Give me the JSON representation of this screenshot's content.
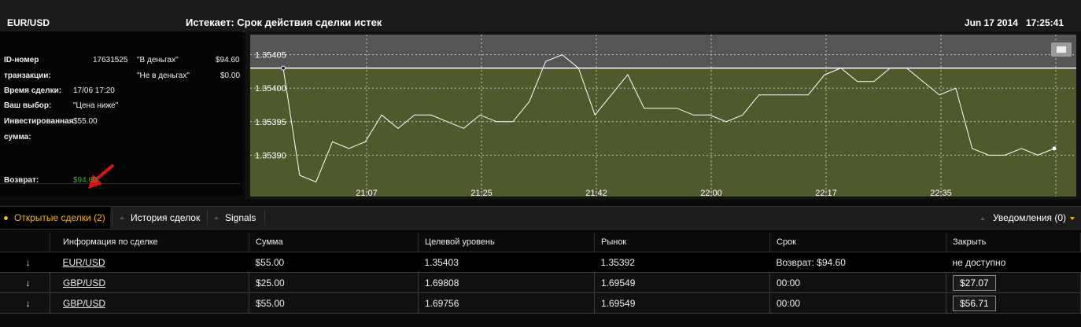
{
  "header": {
    "pair": "EUR/USD",
    "expiry": "Истекает:  Срок действия сделки истек",
    "date": "Jun 17 2014",
    "time": "17:25:41"
  },
  "info": {
    "id_label": "ID-номер",
    "id_label2": "транзакции:",
    "id_value": "17631525",
    "in_money_label": "\"В деньгах\"",
    "in_money_value": "$94.60",
    "out_money_label": "\"Не в деньгах\"",
    "out_money_value": "$0.00",
    "time_label": "Время сделки:",
    "time_value": "17/06 17:20",
    "choice_label": "Ваш выбор:",
    "choice_value": "\"Цена ниже\"",
    "invest_label": "Инвестированная",
    "invest_label2": "сумма:",
    "invest_value": "$55.00",
    "return_label": "Возврат:",
    "return_value": "$94.60"
  },
  "chart_data": {
    "type": "line",
    "x_ticks": [
      "21:07",
      "21:25",
      "21:42",
      "22:00",
      "22:17",
      "22:35"
    ],
    "y_ticks": [
      1.35405,
      1.354,
      1.35395,
      1.3539
    ],
    "y_tick_labels": [
      "1.35405",
      "1.35400",
      "1.35395",
      "1.35390"
    ],
    "ylim": [
      1.35385,
      1.35408
    ],
    "target_level": 1.35403,
    "grid": true,
    "series": [
      {
        "values": [
          1.35403,
          1.35387,
          1.35386,
          1.35392,
          1.35391,
          1.35392,
          1.35396,
          1.35394,
          1.35396,
          1.35396,
          1.35395,
          1.35394,
          1.35396,
          1.35395,
          1.35395,
          1.35398,
          1.35404,
          1.35405,
          1.35403,
          1.35396,
          1.35399,
          1.35402,
          1.35397,
          1.35397,
          1.35397,
          1.35396,
          1.35396,
          1.35395,
          1.35396,
          1.35399,
          1.35399,
          1.35399,
          1.35399,
          1.35402,
          1.35403,
          1.35401,
          1.35401,
          1.35403,
          1.35403,
          1.35401,
          1.35399,
          1.354,
          1.35391,
          1.3539,
          1.3539,
          1.35391,
          1.3539,
          1.35391
        ]
      }
    ]
  },
  "tabs": {
    "open": "Открытые сделки (2)",
    "history": "История сделок",
    "signals": "Signals",
    "notifications": "Уведомления (0)"
  },
  "table": {
    "headers": [
      "Информация по сделке",
      "Сумма",
      "Целевой уровень",
      "Рынок",
      "Срок",
      "Закрыть"
    ],
    "rows": [
      {
        "arrow": "↓",
        "pair": "EUR/USD",
        "amount": "$55.00",
        "target": "1.35403",
        "market": "1.35392",
        "term": "Возврат: $94.60",
        "close": "не доступно"
      },
      {
        "arrow": "↓",
        "pair": "GBP/USD",
        "amount": "$25.00",
        "target": "1.69808",
        "market": "1.69549",
        "term": "00:00",
        "close": "$27.07"
      },
      {
        "arrow": "↓",
        "pair": "GBP/USD",
        "amount": "$55.00",
        "target": "1.69756",
        "market": "1.69549",
        "term": "00:00",
        "close": "$56.71"
      }
    ]
  },
  "colors": {
    "accent": "#f0b800",
    "positive": "#2bb52b",
    "plot_bg": "#4e5a2c"
  }
}
